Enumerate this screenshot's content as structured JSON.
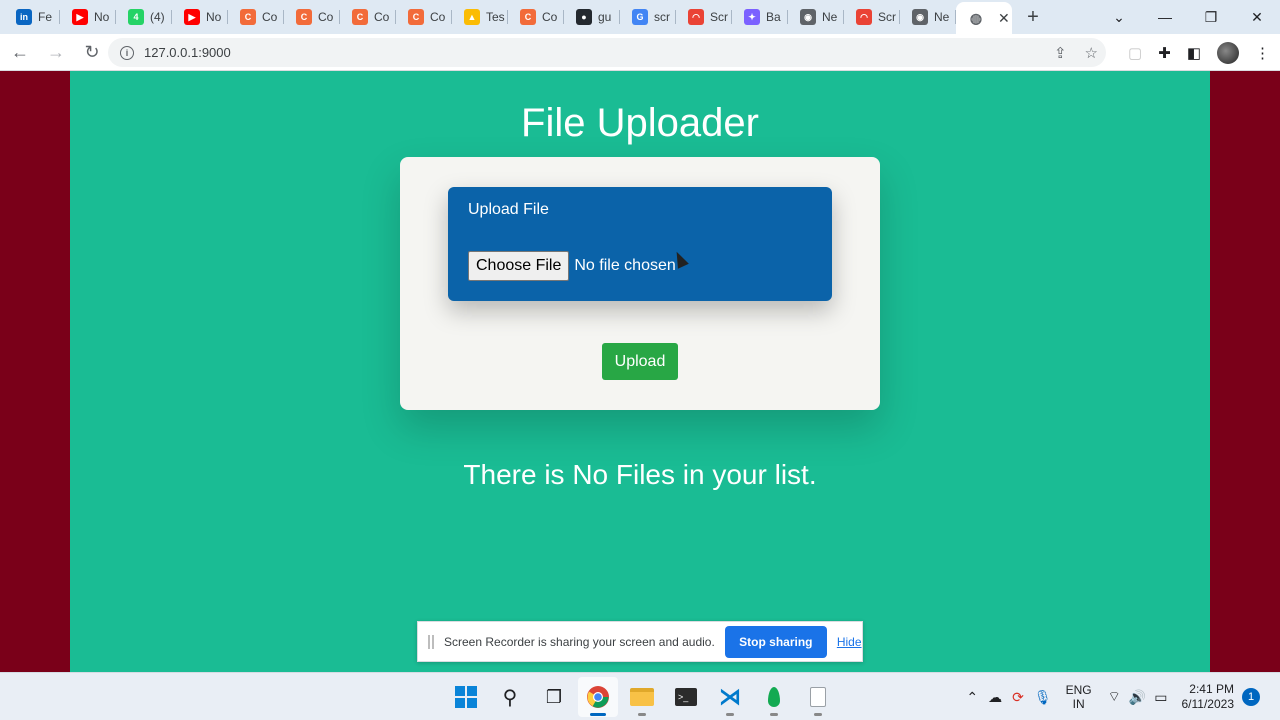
{
  "browser": {
    "tabs": [
      {
        "label": "Fe",
        "icon": "linkedin-icon",
        "color": "#0a66c2",
        "glyph": "in"
      },
      {
        "label": "No",
        "icon": "youtube-icon",
        "color": "#ff0000",
        "glyph": "▶"
      },
      {
        "label": "(4)",
        "icon": "whatsapp-icon",
        "color": "#25d366",
        "glyph": "4"
      },
      {
        "label": "No",
        "icon": "youtube-icon",
        "color": "#ff0000",
        "glyph": "▶"
      },
      {
        "label": "Co",
        "icon": "codepen-icon",
        "color": "#f26b3a",
        "glyph": "C"
      },
      {
        "label": "Co",
        "icon": "codepen-icon",
        "color": "#f26b3a",
        "glyph": "C"
      },
      {
        "label": "Co",
        "icon": "codepen-icon",
        "color": "#f26b3a",
        "glyph": "C"
      },
      {
        "label": "Co",
        "icon": "codepen-icon",
        "color": "#f26b3a",
        "glyph": "C"
      },
      {
        "label": "Tes",
        "icon": "google-drive-icon",
        "color": "#fbbc04",
        "glyph": "▲"
      },
      {
        "label": "Co",
        "icon": "codepen-icon",
        "color": "#f26b3a",
        "glyph": "C"
      },
      {
        "label": "gu",
        "icon": "github-icon",
        "color": "#24292f",
        "glyph": "●"
      },
      {
        "label": "scr",
        "icon": "google-icon",
        "color": "#4285f4",
        "glyph": "G"
      },
      {
        "label": "Scr",
        "icon": "rainbow-icon",
        "color": "#ea4335",
        "glyph": "◠"
      },
      {
        "label": "Ba",
        "icon": "bard-icon",
        "color": "#7b61ff",
        "glyph": "✦"
      },
      {
        "label": "Ne",
        "icon": "chrome-icon",
        "color": "#5f6368",
        "glyph": "◉"
      },
      {
        "label": "Scr",
        "icon": "rainbow-icon",
        "color": "#ea4335",
        "glyph": "◠"
      },
      {
        "label": "Ne",
        "icon": "chrome-icon",
        "color": "#5f6368",
        "glyph": "◉"
      }
    ],
    "active_tab": {
      "icon": "globe-icon",
      "close": "✕"
    },
    "new_tab": "+",
    "url": "127.0.0.1:9000"
  },
  "page": {
    "title": "File Uploader",
    "upload_label": "Upload File",
    "choose_button": "Choose File",
    "no_file": "No file chosen",
    "upload_button": "Upload",
    "empty_message": "There is No Files in your list."
  },
  "share_bar": {
    "text": "Screen Recorder is sharing your screen and audio.",
    "stop_label": "Stop sharing",
    "hide_label": "Hide"
  },
  "taskbar": {
    "lang_top": "ENG",
    "lang_bottom": "IN",
    "time": "2:41 PM",
    "date": "6/11/2023",
    "notifications": "1"
  }
}
